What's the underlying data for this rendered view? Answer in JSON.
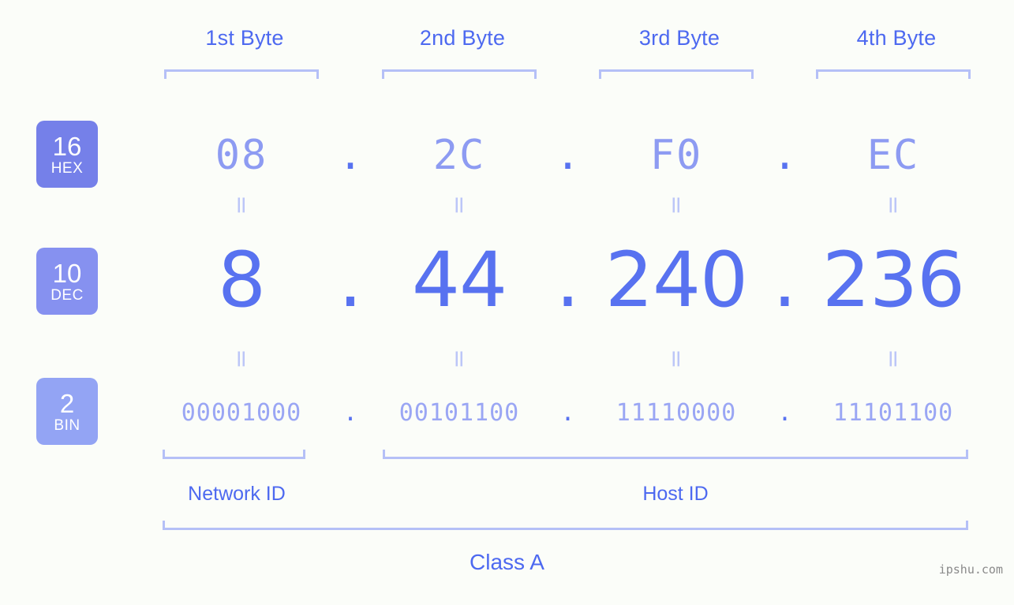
{
  "background_color": "#fbfdf9",
  "colors": {
    "accent_dark": "#4d69f0",
    "accent_mid": "#5872f0",
    "accent_light": "#8d9bf2",
    "accent_lighter": "#9aa6f4",
    "bracket": "#b5c0f7",
    "equals": "#bcc6f8",
    "hex_badge": "#7580e9",
    "dec_badge": "#8691f0",
    "bin_badge": "#93a4f4",
    "watermark": "#8a8a8a"
  },
  "byte_headers": [
    {
      "label": "1st Byte"
    },
    {
      "label": "2nd Byte"
    },
    {
      "label": "3rd Byte"
    },
    {
      "label": "4th Byte"
    }
  ],
  "bases": [
    {
      "number": "16",
      "name": "HEX"
    },
    {
      "number": "10",
      "name": "DEC"
    },
    {
      "number": "2",
      "name": "BIN"
    }
  ],
  "separator": ".",
  "equals_glyph": "=",
  "rows": {
    "hex": {
      "base": "16",
      "name": "HEX",
      "values": [
        "08",
        "2C",
        "F0",
        "EC"
      ]
    },
    "dec": {
      "base": "10",
      "name": "DEC",
      "values": [
        "8",
        "44",
        "240",
        "236"
      ]
    },
    "bin": {
      "base": "2",
      "name": "BIN",
      "values": [
        "00001000",
        "00101100",
        "11110000",
        "11101100"
      ]
    }
  },
  "ip_address": "8.44.240.236",
  "id_sections": [
    {
      "label": "Network ID"
    },
    {
      "label": "Host ID"
    }
  ],
  "class": {
    "label": "Class A"
  },
  "watermark": {
    "text": "ipshu.com"
  }
}
